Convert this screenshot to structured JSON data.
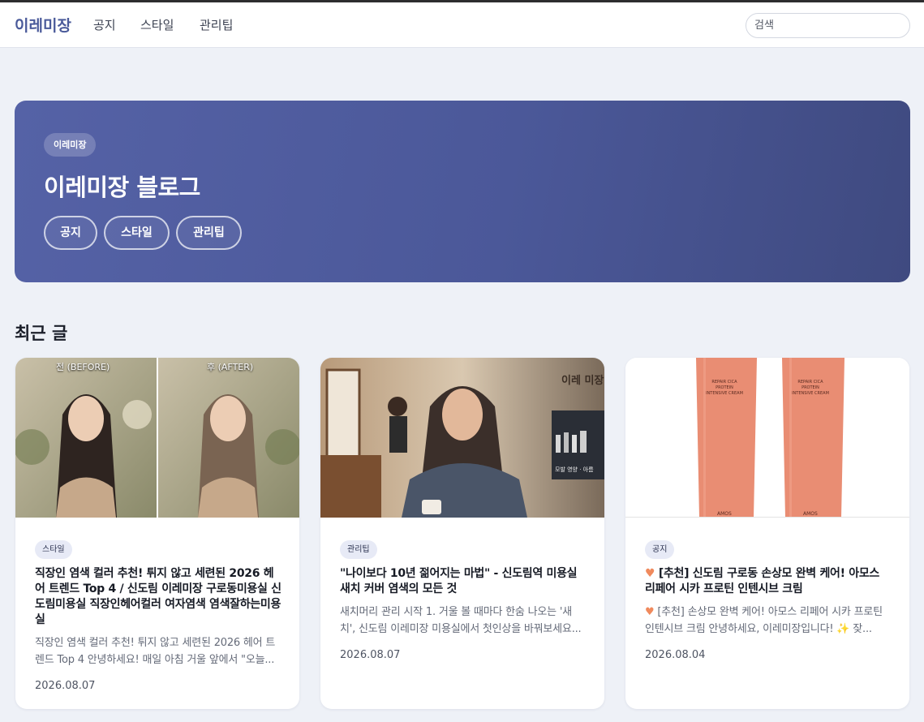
{
  "navbar": {
    "brand": "이레미장",
    "links": [
      "공지",
      "스타일",
      "관리팁"
    ],
    "search_placeholder": "검색"
  },
  "hero": {
    "badge": "이레미장",
    "title": "이레미장 블로그",
    "buttons": [
      "공지",
      "스타일",
      "관리팁"
    ]
  },
  "recent": {
    "title": "최근 글",
    "posts": [
      {
        "tag": "스타일",
        "before_label": "전 (BEFORE)",
        "after_label": "후 (AFTER)",
        "title": "직장인 염색 컬러 추천! 튀지 않고 세련된 2026 헤어 트렌드 Top 4 / 신도림 이레미장 구로동미용실 신도림미용실 직장인헤어컬러 여자염색 염색잘하는미용실",
        "excerpt": "직장인 염색 컬러 추천! 튀지 않고 세련된 2026 헤어 트렌드 Top 4  안녕하세요! 매일 아침 거울 앞에서 \"오늘...",
        "date": "2026.08.07"
      },
      {
        "tag": "관리팁",
        "sign_text": "이레 미장",
        "shelf_text": "모발 영양 · 아름",
        "title": "\"나이보다 10년 젊어지는 마법\" - 신도림역 미용실 새치 커버 염색의 모든 것",
        "excerpt": "새치머리 관리 시작 1. 거울 볼 때마다 한숨 나오는 '새치', 신도림 이레미장 미용실에서 첫인상을 바꿔보세요...",
        "date": "2026.08.07"
      },
      {
        "tag": "공지",
        "tube_label": "REPAIR CICA PROTEIN INTENSIVE CREAM",
        "tube_brand": "AMOS",
        "title": "[추천] 신도림 구로동 손상모 완벽 케어! 아모스 리페어 시카 프로틴 인텐시브 크림",
        "excerpt": "[추천] 손상모 완벽 케어! 아모스 리페어 시카 프로틴 인텐시브 크림 안녕하세요, 이레미장입니다! ✨ 잦...",
        "date": "2026.08.04"
      }
    ]
  },
  "colors": {
    "brand": "#4a5a9a",
    "hero_start": "#5562a6",
    "hero_end": "#3f4a80",
    "tag_bg": "#e7eaf6",
    "page_bg": "#eef1f7",
    "heart": "#f08a5d"
  },
  "icons": {
    "heart": "heart-icon"
  }
}
